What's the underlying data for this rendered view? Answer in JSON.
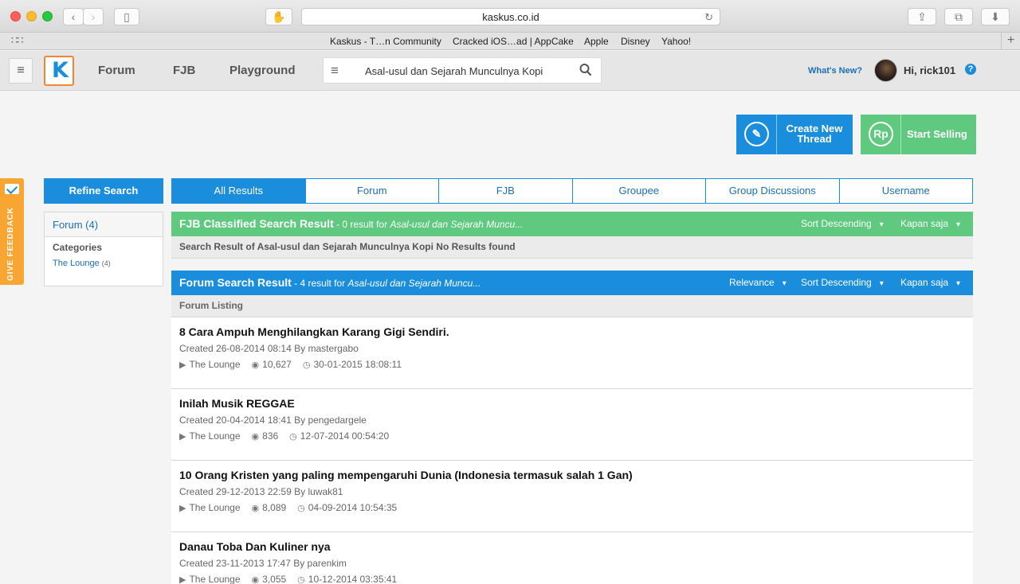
{
  "browser": {
    "address": "kaskus.co.id",
    "favorites": [
      "Kaskus - T…n Community",
      "Cracked iOS…ad | AppCake",
      "Apple",
      "Disney",
      "Yahoo!"
    ]
  },
  "header": {
    "nav": [
      "Forum",
      "FJB",
      "Playground"
    ],
    "search_value": "Asal-usul dan Sejarah Munculnya Kopi",
    "whats_new": "What's New?",
    "greeting": "Hi, rick101"
  },
  "actions": {
    "create_thread": "Create New Thread",
    "start_selling": "Start Selling",
    "sell_icon": "Rp"
  },
  "feedback": "GIVE FEEDBACK",
  "refine": {
    "button": "Refine Search",
    "forum": "Forum (4)",
    "categories_title": "Categories",
    "category": "The Lounge",
    "category_count": "(4)"
  },
  "tabs": [
    "All Results",
    "Forum",
    "FJB",
    "Groupee",
    "Group Discussions",
    "Username"
  ],
  "fjb": {
    "title": "FJB Classified Search Result",
    "summary": " - 0 result for ",
    "query": "Asal-usul dan Sejarah Muncu...",
    "sort": "Sort Descending",
    "time": "Kapan saja",
    "no_results": "Search Result of Asal-usul dan Sejarah Munculnya Kopi No Results found"
  },
  "forum_result": {
    "title": "Forum Search Result",
    "summary": " - 4 result for ",
    "query": "Asal-usul dan Sejarah Muncu...",
    "relevance": "Relevance",
    "sort": "Sort Descending",
    "time": "Kapan saja",
    "listing": "Forum Listing"
  },
  "threads": [
    {
      "title": "8 Cara Ampuh Menghilangkan Karang Gigi Sendiri.",
      "created": "Created 26-08-2014 08:14 By mastergabo",
      "category": "The Lounge",
      "views": "10,627",
      "last": "30-01-2015 18:08:11"
    },
    {
      "title": "Inilah Musik REGGAE",
      "created": "Created 20-04-2014 18:41 By pengedargele",
      "category": "The Lounge",
      "views": "836",
      "last": "12-07-2014 00:54:20"
    },
    {
      "title": "10 Orang Kristen yang paling mempengaruhi Dunia (Indonesia termasuk salah 1 Gan)",
      "created": "Created 29-12-2013 22:59 By luwak81",
      "category": "The Lounge",
      "views": "8,089",
      "last": "04-09-2014 10:54:35"
    },
    {
      "title": "Danau Toba Dan Kuliner nya",
      "created": "Created 23-11-2013 17:47 By parenkim",
      "category": "The Lounge",
      "views": "3,055",
      "last": "10-12-2014 03:35:41"
    }
  ],
  "colors": {
    "blue": "#1a8edc",
    "green": "#5ec97f",
    "orange": "#f8a532"
  }
}
